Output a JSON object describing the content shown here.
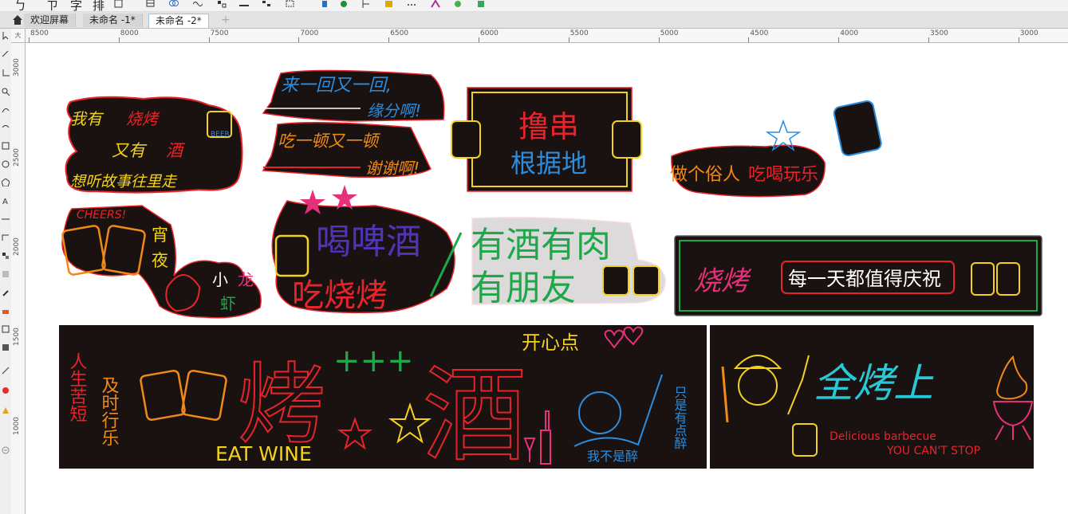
{
  "toolbar": {
    "text_items": [
      "ㄅ",
      "ㄗ",
      "字",
      "排"
    ]
  },
  "tabs": [
    {
      "label": "欢迎屏幕",
      "active": false
    },
    {
      "label": "未命名 -1*",
      "active": false
    },
    {
      "label": "未命名 -2*",
      "active": true
    }
  ],
  "tab_add": "+",
  "ruler_h": [
    "8500",
    "8000",
    "7500",
    "7000",
    "6500",
    "6000",
    "5500",
    "5000",
    "4500",
    "4000",
    "3500",
    "3000"
  ],
  "ruler_v": [
    "3000",
    "2500",
    "2000",
    "1500",
    "1000"
  ],
  "ruler_corner": "大",
  "colors": {
    "panel": "#1a1210",
    "red": "#e8232b",
    "yellow": "#f3d21b",
    "blue": "#2a8de0",
    "orange": "#f08a17",
    "green": "#1fa84a",
    "purple": "#6a3bb0",
    "pink": "#e8307a",
    "cyan": "#28c8d8"
  },
  "signs": {
    "s1": {
      "l1a": "我有",
      "l1b": "烧烤",
      "l2a": "又有",
      "l2b": "酒",
      "l3": "想听故事往里走",
      "badge": "BEER"
    },
    "s2": {
      "l1": "来一回又一回,",
      "l2": "缘分啊!",
      "l3": "吃一顿又一顿",
      "l4": "谢谢啊!"
    },
    "s3": {
      "l1": "撸串",
      "l2": "根据地"
    },
    "s4": {
      "l1a": "做个俗人",
      "l1b": "吃喝玩乐"
    },
    "s5": {
      "l1": "CHEERS!",
      "l2": "宵",
      "l3": "夜",
      "l4a": "小",
      "l4b": "龙",
      "l5": "虾"
    },
    "s6": {
      "l1": "喝啤酒",
      "l2": "吃烧烤"
    },
    "s7": {
      "l1": "有酒有肉",
      "l2": "有朋友"
    },
    "s8": {
      "l1": "烧烤",
      "l2": "每一天都值得庆祝"
    },
    "s9": {
      "c1": "人生苦短",
      "c2": "及时行乐",
      "big": "烤",
      "eng": "EAT WINE"
    },
    "s10": {
      "plus": "+++",
      "top": "开心点",
      "big": "酒",
      "v": "只是有点醉",
      "bubble": "我不是醉"
    },
    "s11": {
      "title": "全烤上",
      "en1": "Delicious barbecue",
      "en2": "YOU CAN'T STOP"
    }
  }
}
